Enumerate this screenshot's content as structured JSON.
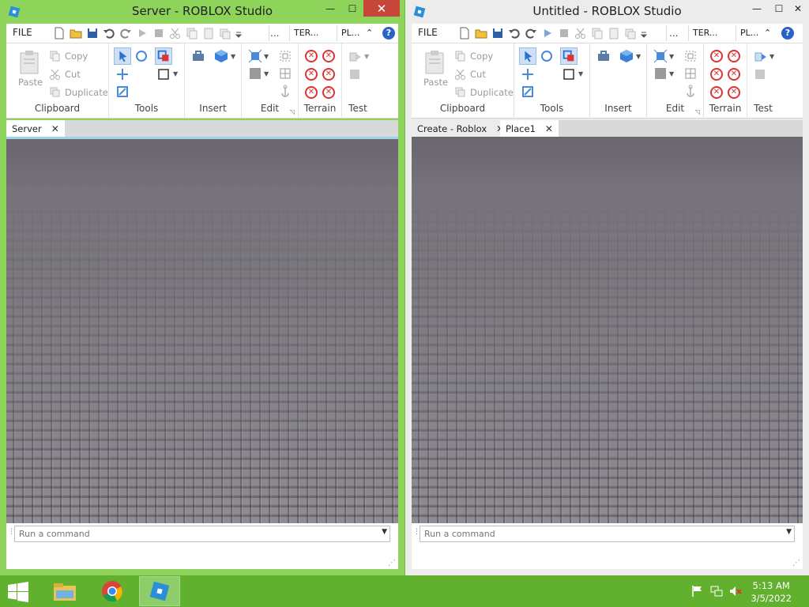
{
  "windows": {
    "server": {
      "title": "Server - ROBLOX Studio",
      "menu_file": "FILE",
      "tab_terrain": "TER...",
      "tab_plugins": "PL...",
      "clipboard": {
        "paste": "Paste",
        "copy": "Copy",
        "cut": "Cut",
        "duplicate": "Duplicate",
        "label": "Clipboard"
      },
      "groups": {
        "tools": "Tools",
        "insert": "Insert",
        "edit": "Edit",
        "terrain": "Terrain",
        "test": "Test"
      },
      "doc_tabs": [
        {
          "label": "Server",
          "close": "✕"
        }
      ],
      "command_placeholder": "Run a command"
    },
    "untitled": {
      "title": "Untitled - ROBLOX Studio",
      "menu_file": "FILE",
      "tab_terrain": "TER...",
      "tab_plugins": "PL...",
      "clipboard": {
        "paste": "Paste",
        "copy": "Copy",
        "cut": "Cut",
        "duplicate": "Duplicate",
        "label": "Clipboard"
      },
      "groups": {
        "tools": "Tools",
        "insert": "Insert",
        "edit": "Edit",
        "terrain": "Terrain",
        "test": "Test"
      },
      "doc_tabs": [
        {
          "label": "Create - Roblox",
          "close": "✕"
        },
        {
          "label": "Place1",
          "close": "✕"
        }
      ],
      "command_placeholder": "Run a command"
    }
  },
  "window_controls": {
    "minimize": "—",
    "maximize": "☐",
    "close": "✕"
  },
  "taskbar": {
    "apps": [
      "file-explorer",
      "chrome",
      "roblox-studio"
    ],
    "clock_time": "5:13 AM",
    "clock_date": "3/5/2022"
  },
  "colors": {
    "accent_green": "#8ed35a",
    "taskbar_green": "#62b12e",
    "close_red": "#c7463a"
  }
}
